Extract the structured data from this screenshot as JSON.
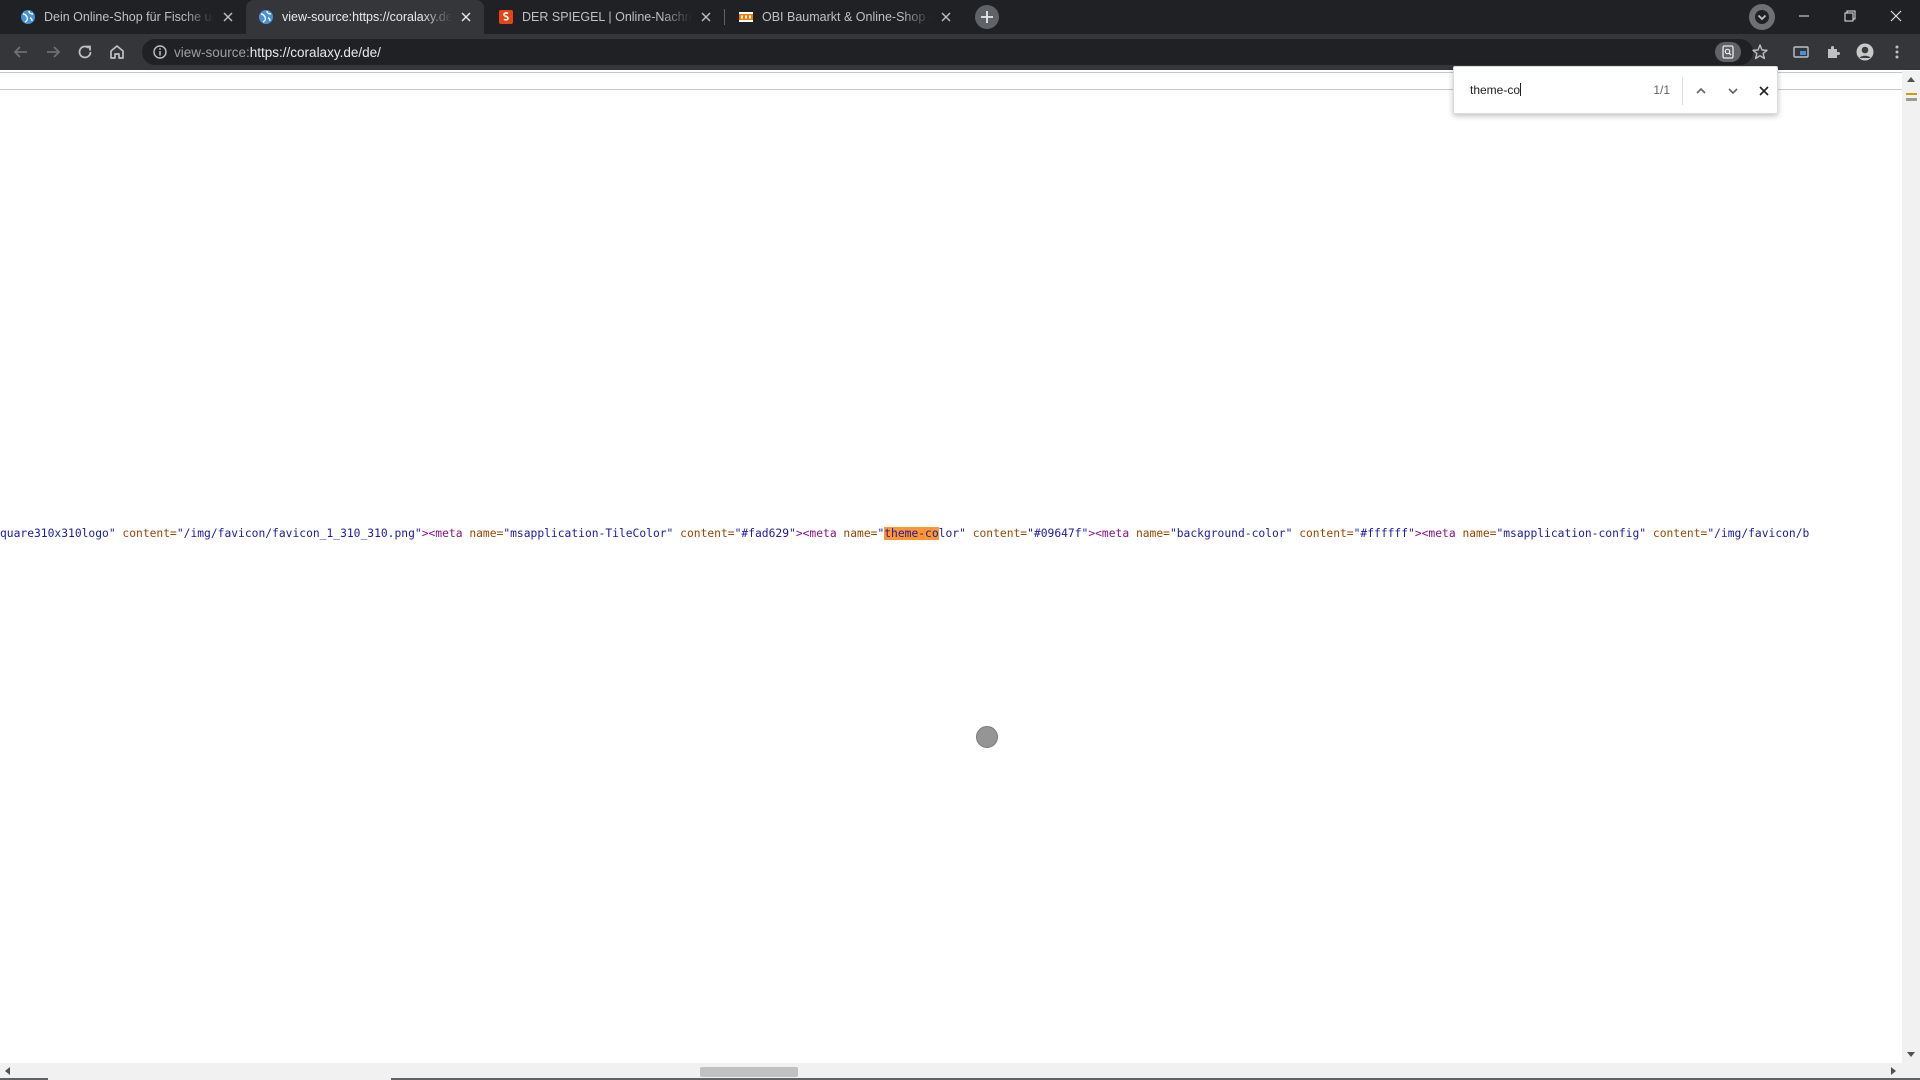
{
  "browser": {
    "tabs": [
      {
        "title": "Dein Online-Shop für Fische und Korallen",
        "favicon": "globe-icon",
        "active": false
      },
      {
        "title": "view-source:https://coralaxy.de/de/",
        "favicon": "globe-icon",
        "active": true
      },
      {
        "title": "DER SPIEGEL | Online-Nachrichten",
        "favicon": "spiegel-icon",
        "active": false
      },
      {
        "title": "OBI Baumarkt & Online-Shop - alles",
        "favicon": "obi-icon",
        "active": false
      }
    ],
    "address_bar": {
      "scheme": "view-source:",
      "url": "https://coralaxy.de/de/"
    }
  },
  "find_bar": {
    "query": "theme-co",
    "match_count": "1/1"
  },
  "source": {
    "line_segments": [
      {
        "c": "av",
        "t": "quare310x310logo\""
      },
      {
        "c": "an",
        "t": " content="
      },
      {
        "c": "av",
        "t": "\"/img/favicon/favicon_1_310_310.png\""
      },
      {
        "c": "tg",
        "t": "><meta "
      },
      {
        "c": "an",
        "t": "name="
      },
      {
        "c": "av",
        "t": "\"msapplication-TileColor\""
      },
      {
        "c": "an",
        "t": " content="
      },
      {
        "c": "av",
        "t": "\"#fad629\""
      },
      {
        "c": "tg",
        "t": "><meta "
      },
      {
        "c": "an",
        "t": "name="
      },
      {
        "c": "av",
        "t": "\""
      },
      {
        "c": "hl",
        "t": "theme-co"
      },
      {
        "c": "av",
        "t": "lor\""
      },
      {
        "c": "an",
        "t": " content="
      },
      {
        "c": "av",
        "t": "\"#09647f\""
      },
      {
        "c": "tg",
        "t": "><meta "
      },
      {
        "c": "an",
        "t": "name="
      },
      {
        "c": "av",
        "t": "\"background-color\""
      },
      {
        "c": "an",
        "t": " content="
      },
      {
        "c": "av",
        "t": "\"#ffffff\""
      },
      {
        "c": "tg",
        "t": "><meta "
      },
      {
        "c": "an",
        "t": "name="
      },
      {
        "c": "av",
        "t": "\"msapplication-config\""
      },
      {
        "c": "an",
        "t": " content="
      },
      {
        "c": "av",
        "t": "\"/img/favicon/b"
      }
    ]
  },
  "colors": {
    "tabstrip": "#202124",
    "toolbar": "#35363a",
    "find_highlight": "#ff9632",
    "tag": "#881280",
    "attr_name": "#994500",
    "attr_value": "#1a1aa6"
  }
}
